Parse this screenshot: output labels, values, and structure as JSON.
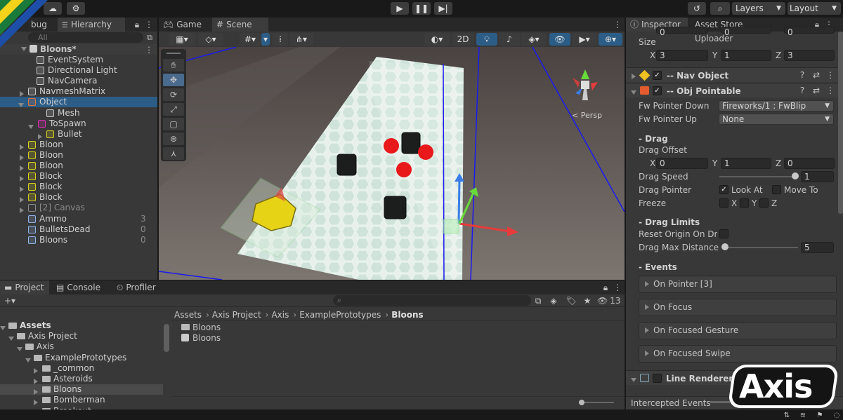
{
  "toolbar": {
    "layers": "Layers",
    "layout": "Layout",
    "undo_icon": "history-icon",
    "search_icon": "search-icon"
  },
  "hierarchy": {
    "tab_debug": "bug",
    "tab_hierarchy": "Hierarchy",
    "search_placeholder": "All",
    "scene": "Bloons*",
    "items": [
      {
        "label": "EventSystem",
        "count": ""
      },
      {
        "label": "Directional Light",
        "count": ""
      },
      {
        "label": "NavCamera",
        "count": ""
      },
      {
        "label": "NavmeshMatrix",
        "count": ""
      },
      {
        "label": "Object",
        "count": ""
      },
      {
        "label": "Mesh",
        "count": ""
      },
      {
        "label": "ToSpawn",
        "count": ""
      },
      {
        "label": "Bullet",
        "count": ""
      },
      {
        "label": "Bloon",
        "count": ""
      },
      {
        "label": "Bloon",
        "count": ""
      },
      {
        "label": "Bloon",
        "count": ""
      },
      {
        "label": "Block",
        "count": ""
      },
      {
        "label": "Block",
        "count": ""
      },
      {
        "label": "Block",
        "count": ""
      },
      {
        "label": "[2] Canvas",
        "count": ""
      },
      {
        "label": "Ammo",
        "count": "3"
      },
      {
        "label": "BulletsDead",
        "count": "0"
      },
      {
        "label": "Bloons",
        "count": "0"
      }
    ]
  },
  "scene": {
    "tab_game": "Game",
    "tab_scene": "Scene",
    "btn_2d": "2D",
    "persp": "< Persp"
  },
  "project": {
    "tab_project": "Project",
    "tab_console": "Console",
    "tab_profiler": "Profiler",
    "visible_count": "13",
    "breadcrumb": [
      "Assets",
      "Axis Project",
      "Axis",
      "ExamplePrototypes",
      "Bloons"
    ],
    "tree": [
      "Assets",
      "Axis Project",
      "Axis",
      "ExamplePrototypes",
      "_common",
      "Asteroids",
      "Bloons",
      "Bomberman",
      "Breakout"
    ],
    "files": [
      "Bloons",
      "Bloons"
    ]
  },
  "inspector": {
    "tab_inspector": "Inspector",
    "tab_asset_store": "Asset Store Uploader",
    "top_x": "0",
    "top_y": "0",
    "top_z": "0",
    "size_label": "Size",
    "size_x": "3",
    "size_y": "1",
    "size_z": "3",
    "nav_object": "-- Nav Object",
    "obj_pointable": "-- Obj Pointable",
    "fw_pointer_down_label": "Fw Pointer Down",
    "fw_pointer_down": "Fireworks/1 : FwBlip",
    "fw_pointer_up_label": "Fw Pointer Up",
    "fw_pointer_up": "None",
    "drag_header": "- Drag",
    "drag_offset_label": "Drag Offset",
    "drag_offset_x": "0",
    "drag_offset_y": "1",
    "drag_offset_z": "0",
    "drag_speed_label": "Drag Speed",
    "drag_speed": "1",
    "drag_speed_fraction": 0.97,
    "drag_pointer_label": "Drag Pointer",
    "look_at": "Look At",
    "move_to": "Move To",
    "freeze_label": "Freeze",
    "fx": "X",
    "fy": "Y",
    "fz": "Z",
    "drag_limits_header": "- Drag Limits",
    "reset_origin_label": "Reset Origin On Drop",
    "drag_max_label": "Drag Max Distance",
    "drag_max": "5",
    "drag_max_fraction": 0.0,
    "events_header": "- Events",
    "events": [
      "On Pointer [3]",
      "On Focus",
      "On Focused Gesture",
      "On Focused Swipe"
    ],
    "line_renderer": "Line Renderer",
    "intercepted": "Intercepted Events",
    "x": "X",
    "y": "Y",
    "z": "Z"
  },
  "logo": {
    "text": "Axis"
  },
  "colors": {
    "accent": "#2c5d87",
    "selection": "#2c5d87",
    "panel": "#383838",
    "dark": "#282828"
  }
}
